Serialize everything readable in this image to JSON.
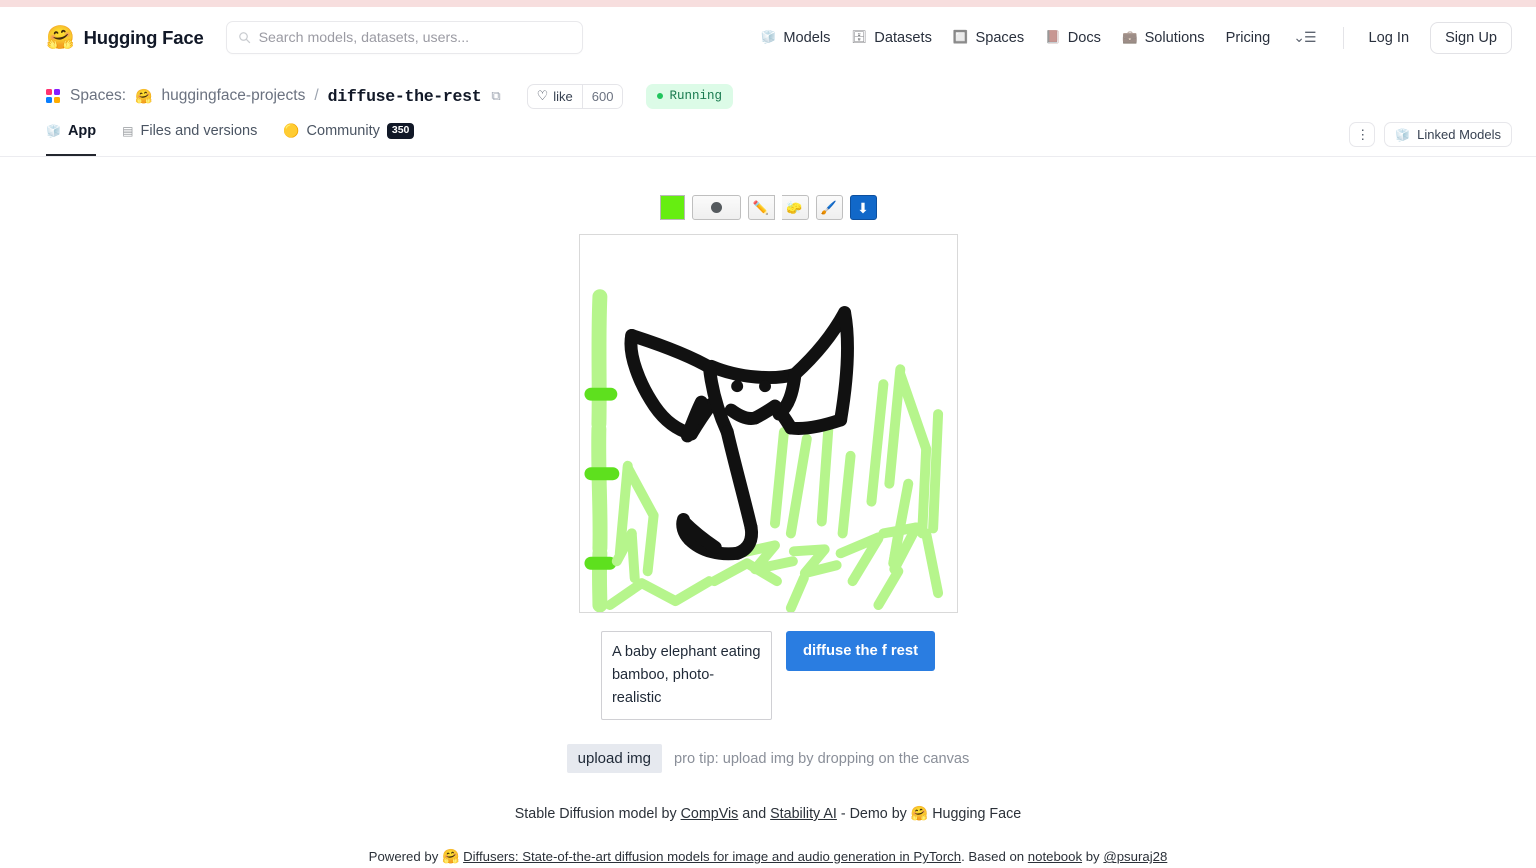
{
  "navbar": {
    "brand_logo_icon": "hugging-face-emoji",
    "brand_name": "Hugging Face",
    "search_placeholder": "Search models, datasets, users...",
    "search_value": "",
    "links": [
      {
        "label": "Models",
        "icon": "cube-icon"
      },
      {
        "label": "Datasets",
        "icon": "database-icon"
      },
      {
        "label": "Spaces",
        "icon": "grid-icon"
      },
      {
        "label": "Docs",
        "icon": "book-icon"
      },
      {
        "label": "Solutions",
        "icon": "briefcase-icon"
      },
      {
        "label": "Pricing",
        "icon": ""
      }
    ],
    "menu_icon": "chevron-down-list-icon",
    "login_label": "Log In",
    "signup_label": "Sign Up"
  },
  "space_header": {
    "spaces_label": "Spaces:",
    "owner": "huggingface-projects",
    "separator": "/",
    "name": "diffuse-the-rest",
    "copy_icon": "copy-icon",
    "like_label": "like",
    "like_count": "600",
    "status": "Running"
  },
  "tabs": {
    "items": [
      {
        "label": "App",
        "icon": "cube-icon",
        "active": true,
        "count": ""
      },
      {
        "label": "Files and versions",
        "icon": "files-icon",
        "active": false,
        "count": ""
      },
      {
        "label": "Community",
        "icon": "community-emoji",
        "active": false,
        "count": "350"
      }
    ],
    "kebab_label": "⋮",
    "linked_models_label": "Linked Models",
    "linked_models_icon": "cube-icon"
  },
  "draw_toolbar": {
    "color_value": "#66ee11",
    "color_title": "color-swatch",
    "tools": [
      {
        "name": "brush-size-button",
        "icon": "filled-circle"
      },
      {
        "name": "pencil-tool-button",
        "icon": "✏️"
      },
      {
        "name": "eraser-tool-button",
        "icon": "🧽"
      },
      {
        "name": "brush-tool-button",
        "icon": "🖌️"
      },
      {
        "name": "download-button",
        "icon": "⬇"
      }
    ]
  },
  "canvas": {
    "name": "drawing-canvas",
    "description": "hand-drawn sketch of an elephant head with trunk surrounded by green bamboo and grass",
    "background": "#ffffff",
    "stroke_black": "#111111",
    "grass_light": "#adf283",
    "grass_bright": "#5ee01e"
  },
  "prompt": {
    "value": "A baby elephant eating bamboo, photo-realistic",
    "placeholder": "",
    "submit_label": "diffuse the f rest",
    "submit_color": "#2a7de1"
  },
  "upload": {
    "button_label": "upload img",
    "tip": "pro tip: upload img by dropping on the canvas"
  },
  "footer": {
    "line1_prefix": "Stable Diffusion model by ",
    "link_compvis": "CompVis",
    "line1_mid": " and ",
    "link_stability": "Stability AI",
    "line1_suffix": " - Demo by ",
    "hf_emoji": "🤗",
    "line1_end": " Hugging Face",
    "line2_prefix": "Powered by ",
    "link_diffusers": "Diffusers: State-of-the-art diffusion models for image and audio generation in PyTorch",
    "line2_mid": ". Based on ",
    "link_notebook": "notebook",
    "line2_by": " by ",
    "link_author": "@psuraj28"
  }
}
